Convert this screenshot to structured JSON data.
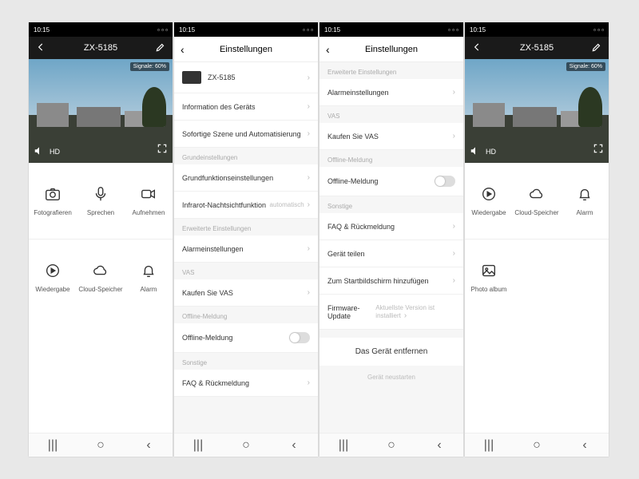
{
  "status": {
    "time": "10:15"
  },
  "camheader": {
    "title": "ZX-5185"
  },
  "video": {
    "signal_badge": "Signale: 60%",
    "hd": "HD"
  },
  "controls1": {
    "photo": "Fotografieren",
    "talk": "Sprechen",
    "record": "Aufnehmen",
    "playback": "Wiedergabe",
    "cloud": "Cloud-Speicher",
    "alarm": "Alarm"
  },
  "controls4": {
    "playback": "Wiedergabe",
    "cloud": "Cloud-Speicher",
    "alarm": "Alarm",
    "album": "Photo album"
  },
  "settings": {
    "title": "Einstellungen",
    "device_name": "ZX-5185",
    "info": "Information des Geräts",
    "scene": "Sofortige Szene und Automatisierung",
    "sect_basic": "Grundeinstellungen",
    "basic": "Grundfunktionseinstellungen",
    "ir": "Infrarot-Nachtsichtfunktion",
    "ir_value": "automatisch",
    "sect_adv": "Erweiterte Einstellungen",
    "alarm": "Alarmeinstellungen",
    "sect_vas": "VAS",
    "vas": "Kaufen Sie VAS",
    "sect_offline": "Offline-Meldung",
    "offline": "Offline-Meldung",
    "sect_other": "Sonstige",
    "faq": "FAQ & Rückmeldung",
    "share": "Gerät teilen",
    "addhome": "Zum Startbildschirm hinzufügen",
    "firmware": "Firmware-Update",
    "firmware_value": "Aktuellste Version ist installiert",
    "remove": "Das Gerät entfernen",
    "restart": "Gerät neustarten"
  }
}
